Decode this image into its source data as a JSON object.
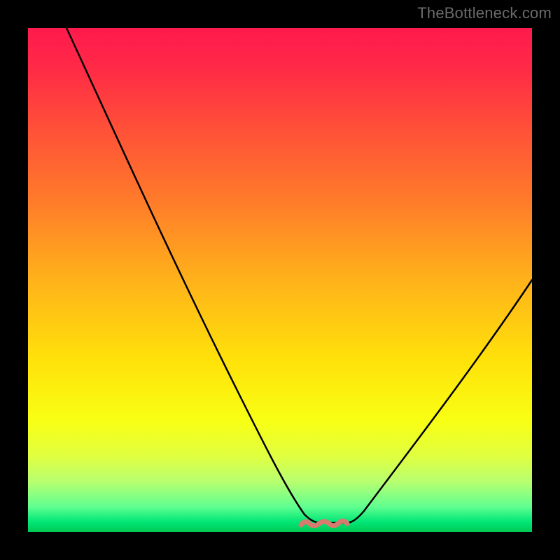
{
  "watermark": "TheBottleneck.com",
  "colors": {
    "curve": "#000000",
    "bump": "#d97a6e",
    "frame": "#000000"
  },
  "chart_data": {
    "type": "line",
    "title": "",
    "xlabel": "",
    "ylabel": "",
    "xlim": [
      0,
      100
    ],
    "ylim": [
      0,
      100
    ],
    "series": [
      {
        "name": "bottleneck-curve",
        "x": [
          0,
          10,
          20,
          30,
          40,
          48,
          52,
          58,
          62,
          70,
          80,
          90,
          100
        ],
        "y": [
          100,
          82,
          64,
          46,
          28,
          10,
          2,
          1,
          1,
          8,
          22,
          38,
          55
        ]
      }
    ],
    "annotations": [
      {
        "name": "minimum-bump",
        "x_center": 59,
        "width": 10,
        "y": 1.5,
        "color": "#d97a6e"
      }
    ]
  }
}
